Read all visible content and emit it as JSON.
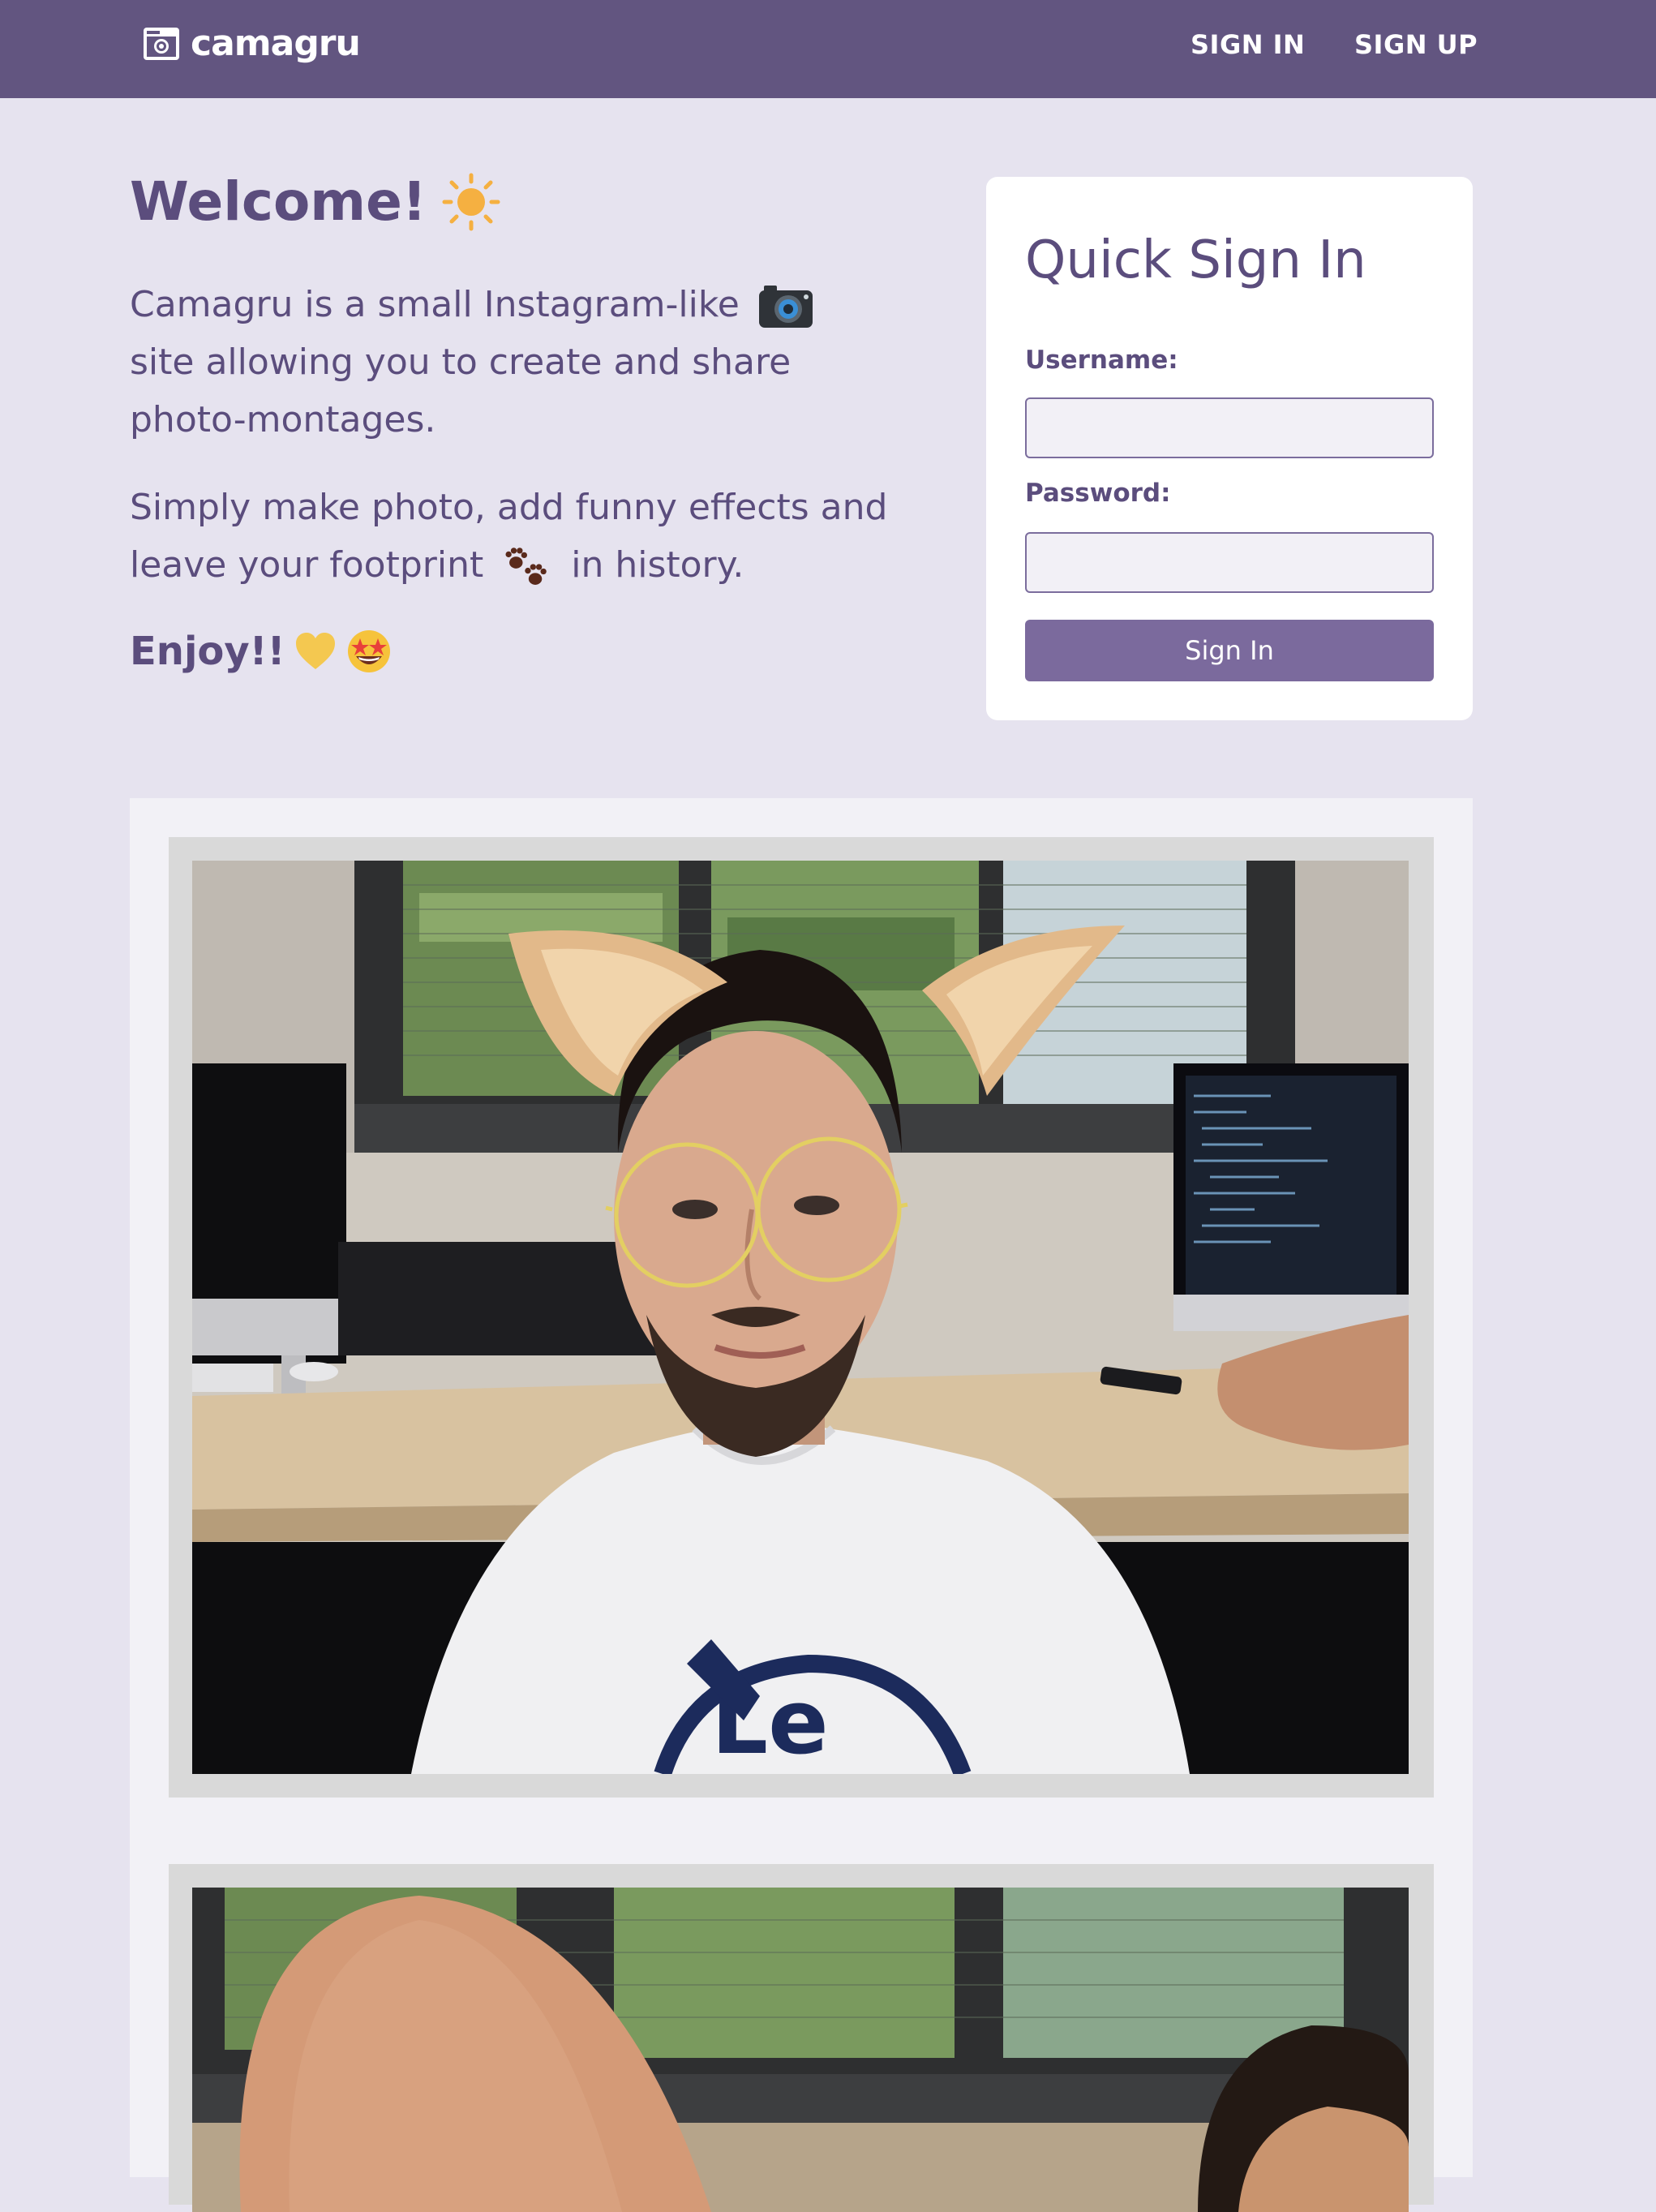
{
  "navbar": {
    "brand": "camagru",
    "links": [
      "SIGN IN",
      "SIGN UP"
    ]
  },
  "welcome": {
    "title": "Welcome!",
    "p1_before": "Camagru is a small Instagram-like",
    "p1_after": "site allowing you to create and share photo-montages.",
    "p2_before": "Simply make photo, add funny effects and leave your footprint",
    "p2_after": "in history.",
    "enjoy": "Enjoy!!"
  },
  "signin": {
    "title": "Quick Sign In",
    "username_label": "Username:",
    "password_label": "Password:",
    "button": "Sign In"
  },
  "gallery": {
    "posts": [
      {
        "description": "webcam photo of a man with cat ears and round glasses stickers"
      },
      {
        "description": "webcam photo of a bald head"
      }
    ]
  },
  "colors": {
    "navbar": "#625580",
    "background": "#e6e3ef",
    "text": "#5b4d7d",
    "button": "#7b6a9d",
    "card": "#ffffff",
    "gallery": "#f2f1f6",
    "frame": "#d9d9d9"
  },
  "icons": [
    "camera-logo-icon",
    "sun-icon",
    "camera-emoji-icon",
    "paw-prints-icon",
    "yellow-heart-icon",
    "star-struck-icon"
  ]
}
